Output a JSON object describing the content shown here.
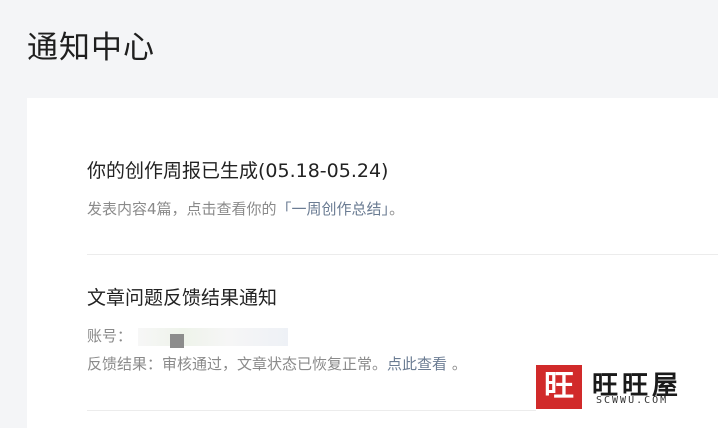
{
  "page": {
    "title": "通知中心"
  },
  "notices": [
    {
      "title": "你的创作周报已生成(05.18-05.24)",
      "desc_prefix": "发表内容4篇，点击查看你的",
      "desc_link": "「一周创作总结」",
      "desc_suffix": "。"
    },
    {
      "title": "文章问题反馈结果通知",
      "account_label": "账号：",
      "result_label": "反馈结果：",
      "result_text": "审核通过，文章状态已恢复正常。",
      "result_link": "点此查看",
      "result_suffix": "。"
    }
  ],
  "watermark": {
    "seal": "旺",
    "text": "旺旺屋",
    "domain": "SCWWU.COM"
  },
  "colors": {
    "background": "#f4f5f7",
    "card": "#ffffff",
    "link": "#3a5a8c",
    "muted": "#8a8a8a",
    "seal": "#d12a2a"
  }
}
